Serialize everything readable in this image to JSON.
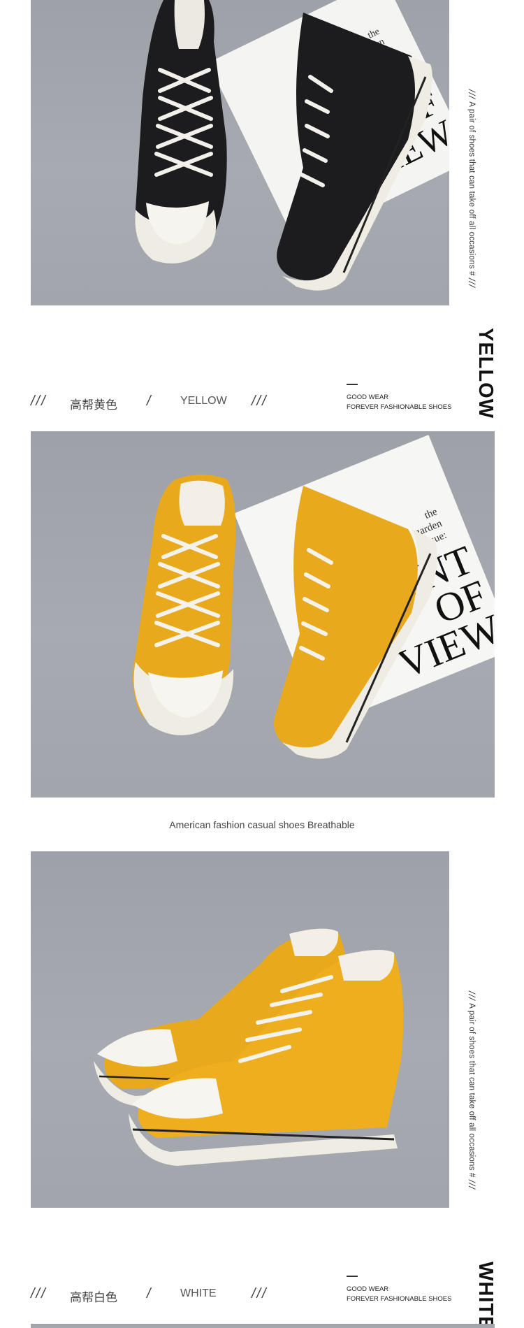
{
  "side_tagline": {
    "slashes_open": "///",
    "text": "A pair of shoes that can take off all occasions #",
    "slashes_close": "///"
  },
  "sections": [
    {
      "color_label_vertical": "YELLOW",
      "caption": {
        "slash1": "///",
        "cn": "高帮黄色",
        "slash2": "/",
        "en": "YELLOW",
        "slash3": "///"
      },
      "goodwear": {
        "line1": "GOOD WEAR",
        "line2": "FOREVER FASHIONABLE SHOES"
      }
    },
    {
      "color_label_vertical": "WHITE",
      "caption": {
        "slash1": "///",
        "cn": "高帮白色",
        "slash2": "/",
        "en": "WHITE",
        "slash3": "///"
      },
      "goodwear": {
        "line1": "GOOD WEAR",
        "line2": "FOREVER FASHIONABLE SHOES"
      }
    }
  ],
  "tagline": "American fashion casual shoes Breathable",
  "card_text": {
    "the": "the",
    "garden": "garden",
    "issue": "issue:",
    "point": "POINT",
    "of": "OF",
    "view": "VIEW"
  },
  "colors": {
    "photo_bg": "#a2a5ac",
    "canvas_black": "#1c1c1e",
    "canvas_yellow": "#e8a91c",
    "rubber_white": "#efece3",
    "text_dark": "#111111"
  },
  "images": [
    "black-high-top-sneakers-photo",
    "yellow-high-top-sneakers-top-view-photo",
    "yellow-high-top-sneakers-side-view-photo",
    "next-product-photo"
  ]
}
